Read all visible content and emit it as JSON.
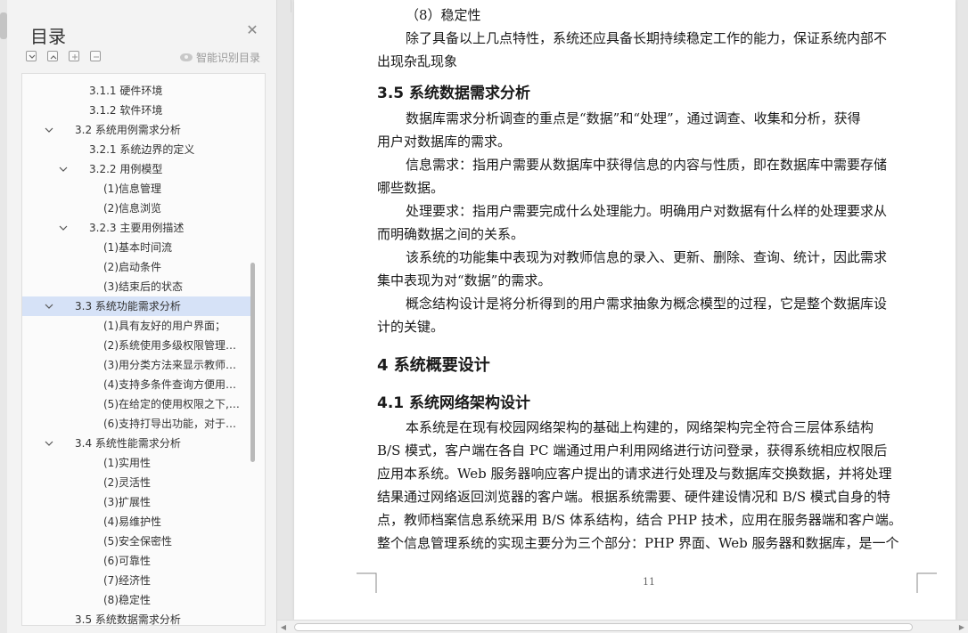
{
  "nav": {
    "title": "目录",
    "close_icon": "close-icon",
    "tools": [
      "collapse-all-icon",
      "expand-all-icon",
      "add-heading-icon",
      "remove-heading-icon"
    ],
    "smart_label": "智能识别目录"
  },
  "toc": [
    {
      "label": "3.1.1  硬件环境",
      "level": 3,
      "caret": "none"
    },
    {
      "label": "3.1.2  软件环境",
      "level": 3,
      "caret": "none"
    },
    {
      "label": "3.2  系统用例需求分析",
      "level": 2,
      "caret": "down"
    },
    {
      "label": "3.2.1  系统边界的定义",
      "level": 3,
      "caret": "none"
    },
    {
      "label": "3.2.2  用例模型",
      "level": 3,
      "caret": "down"
    },
    {
      "label": "(1)信息管理",
      "level": 4,
      "caret": "none"
    },
    {
      "label": "(2)信息浏览",
      "level": 4,
      "caret": "none"
    },
    {
      "label": "3.2.3  主要用例描述",
      "level": 3,
      "caret": "down"
    },
    {
      "label": "(1)基本时间流",
      "level": 4,
      "caret": "none"
    },
    {
      "label": "(2)启动条件",
      "level": 4,
      "caret": "none"
    },
    {
      "label": "(3)结束后的状态",
      "level": 4,
      "caret": "none"
    },
    {
      "label": "3.3  系统功能需求分析",
      "level": 2,
      "caret": "down",
      "selected": true
    },
    {
      "label": "(1)具有友好的用户界面；",
      "level": 4,
      "caret": "none"
    },
    {
      "label": "(2)系统使用多级权限管理，合理分配...",
      "level": 4,
      "caret": "none"
    },
    {
      "label": "(3)用分类方法来显示教师的档案信息...",
      "level": 4,
      "caret": "none"
    },
    {
      "label": "(4)支持多条件查询方便用户使用...",
      "level": 4,
      "caret": "none"
    },
    {
      "label": "(5)在给定的使用权限之下,对数据...",
      "level": 4,
      "caret": "none"
    },
    {
      "label": "(6)支持打导出功能，对于教师档案...",
      "level": 4,
      "caret": "none"
    },
    {
      "label": "3.4  系统性能需求分析",
      "level": 2,
      "caret": "down"
    },
    {
      "label": "(1)实用性",
      "level": 4,
      "caret": "none"
    },
    {
      "label": "(2)灵活性",
      "level": 4,
      "caret": "none"
    },
    {
      "label": "(3)扩展性",
      "level": 4,
      "caret": "none"
    },
    {
      "label": "(4)易维护性",
      "level": 4,
      "caret": "none"
    },
    {
      "label": "(5)安全保密性",
      "level": 4,
      "caret": "none"
    },
    {
      "label": "(6)可靠性",
      "level": 4,
      "caret": "none"
    },
    {
      "label": "(7)经济性",
      "level": 4,
      "caret": "none"
    },
    {
      "label": "(8)稳定性",
      "level": 4,
      "caret": "none"
    },
    {
      "label": "3.5  系统数据需求分析",
      "level": 2,
      "caret": "none"
    }
  ],
  "doc": {
    "lines": [
      {
        "kind": "p",
        "indent": 2,
        "text": "（8）稳定性"
      },
      {
        "kind": "p",
        "indent": 2,
        "text": "除了具备以上几点特性，系统还应具备长期持续稳定工作的能力，保证系统内部不"
      },
      {
        "kind": "p",
        "indent": 0,
        "text": "出现杂乱现象"
      },
      {
        "kind": "h3",
        "indent": 0,
        "text": "3.5   系统数据需求分析"
      },
      {
        "kind": "p",
        "indent": 2,
        "text": "数据库需求分析调查的重点是“数据”和“处理”，通过调查、收集和分析，获得"
      },
      {
        "kind": "p",
        "indent": 0,
        "text": "用户对数据库的需求。"
      },
      {
        "kind": "p",
        "indent": 2,
        "text": "信息需求：指用户需要从数据库中获得信息的内容与性质，即在数据库中需要存储"
      },
      {
        "kind": "p",
        "indent": 0,
        "text": "哪些数据。"
      },
      {
        "kind": "p",
        "indent": 2,
        "text": "处理要求：指用户需要完成什么处理能力。明确用户对数据有什么样的处理要求从"
      },
      {
        "kind": "p",
        "indent": 0,
        "text": "而明确数据之间的关系。"
      },
      {
        "kind": "p",
        "indent": 2,
        "text": "该系统的功能集中表现为对教师信息的录入、更新、删除、查询、统计，因此需求"
      },
      {
        "kind": "p",
        "indent": 0,
        "text": "集中表现为对“数据”的需求。"
      },
      {
        "kind": "p",
        "indent": 2,
        "text": "概念结构设计是将分析得到的用户需求抽象为概念模型的过程，它是整个数据库设"
      },
      {
        "kind": "p",
        "indent": 0,
        "text": "计的关键。"
      },
      {
        "kind": "h2",
        "indent": 0,
        "text": "4   系统概要设计"
      },
      {
        "kind": "h3",
        "indent": 0,
        "text": "4.1   系统网络架构设计"
      },
      {
        "kind": "p",
        "indent": 2,
        "text": "本系统是在现有校园网络架构的基础上构建的，网络架构完全符合三层体系结构"
      },
      {
        "kind": "p",
        "indent": 0,
        "text": "B/S 模式，客户端在各自 PC 端通过用户利用网络进行访问登录，获得系统相应权限后"
      },
      {
        "kind": "p",
        "indent": 0,
        "text": "应用本系统。Web 服务器响应客户提出的请求进行处理及与数据库交换数据，并将处理"
      },
      {
        "kind": "p",
        "indent": 0,
        "text": "结果通过网络返回浏览器的客户端。根据系统需要、硬件建设情况和 B/S 模式自身的特"
      },
      {
        "kind": "p",
        "indent": 0,
        "text": "点，教师档案信息系统采用 B/S 体系结构，结合 PHP 技术，应用在服务器端和客户端。"
      },
      {
        "kind": "p",
        "indent": 0,
        "text": "整个信息管理系统的实现主要分为三个部分：PHP 界面、Web 服务器和数据库，是一个"
      }
    ],
    "page_number": "11"
  }
}
